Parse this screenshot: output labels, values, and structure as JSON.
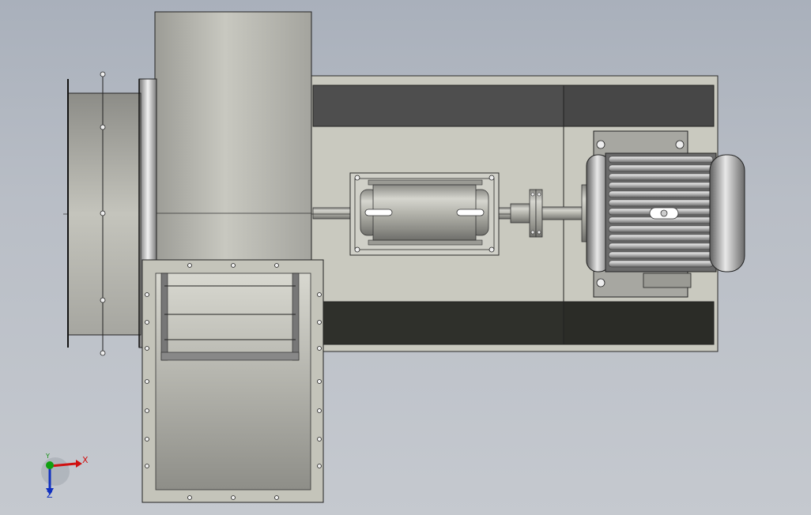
{
  "scene": {
    "background_top": "#a9b0bb",
    "background_bottom": "#c5c9cf"
  },
  "parts": {
    "blower_housing": "fan-scroll-housing",
    "inlet": "inlet-cylinder",
    "outlet": "outlet-flange-duct",
    "base_frame": "base-frame",
    "bearing": "bearing-housing",
    "coupling": "flange-coupling",
    "motor": "electric-motor"
  },
  "colors": {
    "frame_light": "#c9c9bf",
    "frame_dark": "#4e4e4e",
    "metal_mid": "#b8b8b0",
    "axis_x": "#d01010",
    "axis_y": "#10a010",
    "axis_z": "#1030c0"
  },
  "triad": {
    "x_label": "X",
    "y_label": "Y",
    "z_label": "Z"
  }
}
